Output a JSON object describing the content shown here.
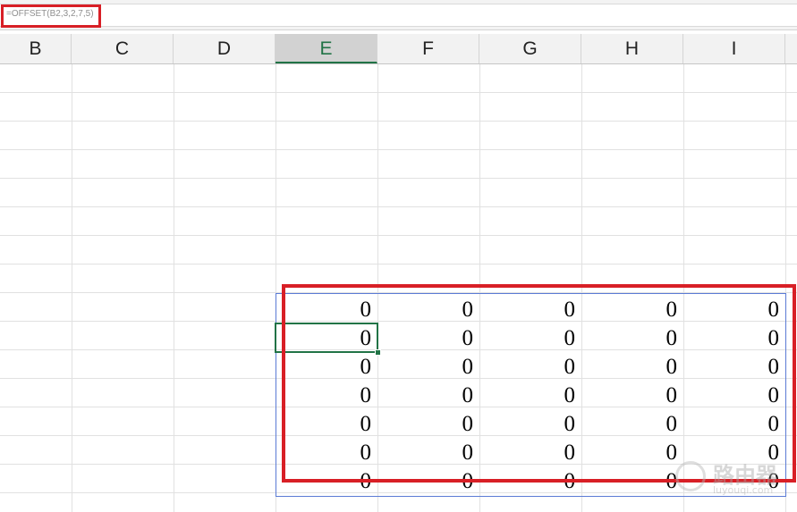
{
  "formula_bar": {
    "formula": "=OFFSET(B2,3,2,7,5)"
  },
  "columns": [
    {
      "letter": "B"
    },
    {
      "letter": "C"
    },
    {
      "letter": "D"
    },
    {
      "letter": "E",
      "selected": true
    },
    {
      "letter": "F"
    },
    {
      "letter": "G"
    },
    {
      "letter": "H"
    },
    {
      "letter": "I"
    }
  ],
  "result_range": {
    "rows": [
      [
        "0",
        "0",
        "0",
        "0",
        "0"
      ],
      [
        "0",
        "0",
        "0",
        "0",
        "0"
      ],
      [
        "0",
        "0",
        "0",
        "0",
        "0"
      ],
      [
        "0",
        "0",
        "0",
        "0",
        "0"
      ],
      [
        "0",
        "0",
        "0",
        "0",
        "0"
      ],
      [
        "0",
        "0",
        "0",
        "0",
        "0"
      ],
      [
        "0",
        "0",
        "0",
        "0",
        "0"
      ]
    ]
  },
  "watermark": {
    "text": "路由器",
    "subtext": "luyouqi.com"
  },
  "colors": {
    "highlight_red": "#d81f26",
    "excel_green": "#217346",
    "selection_blue": "#5b7bd5"
  }
}
